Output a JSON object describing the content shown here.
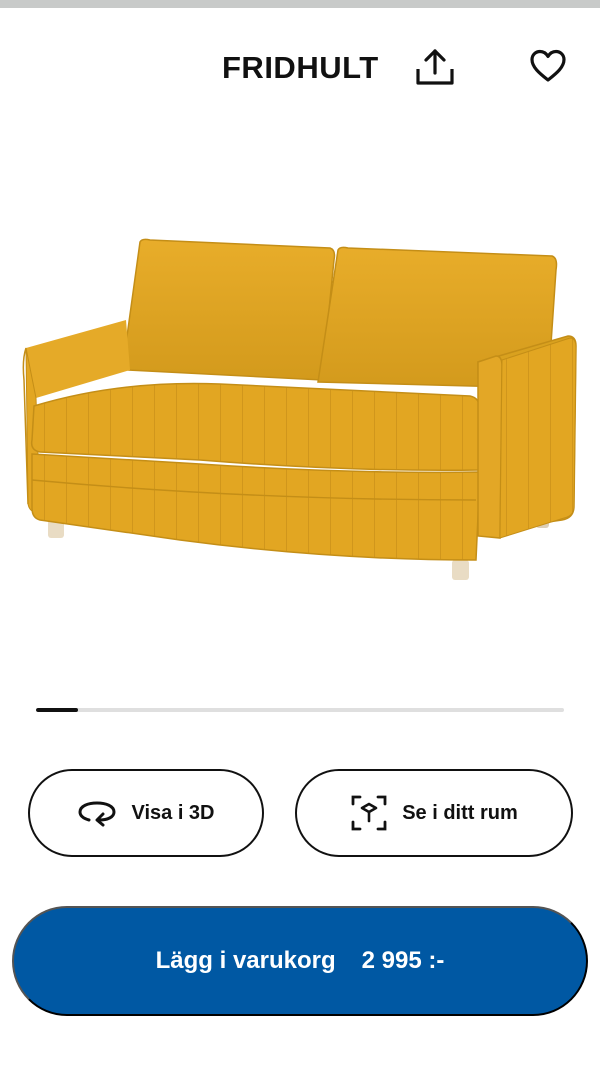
{
  "header": {
    "title": "FRIDHULT",
    "share_icon": "share-upload-icon",
    "favorite_icon": "heart-outline-icon"
  },
  "product": {
    "image_alt": "yellow two-seat sofa bed",
    "color": "#e2a622"
  },
  "carousel": {
    "current_index": 1,
    "total": 13,
    "progress_fraction": 0.08
  },
  "actions": {
    "view_3d_label": "Visa i 3D",
    "view_3d_icon": "rotate-3d-icon",
    "view_room_label": "Se i ditt rum",
    "view_room_icon": "ar-cube-icon"
  },
  "cart": {
    "label": "Lägg i varukorg",
    "price": "2 995 :-",
    "color": "#0058a3"
  }
}
